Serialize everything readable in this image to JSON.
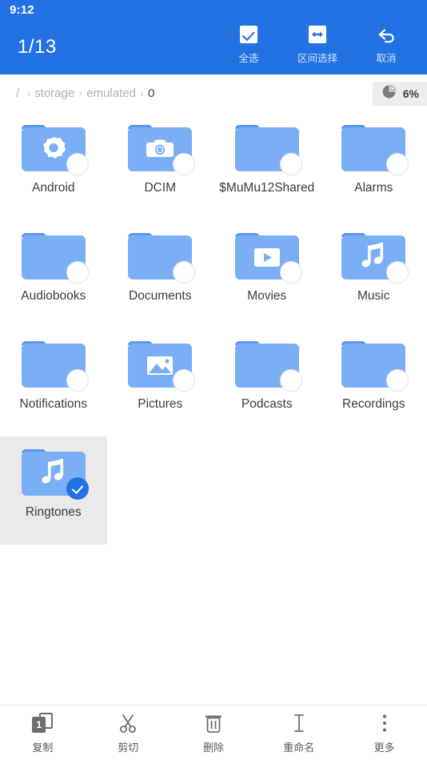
{
  "status_bar": {
    "time": "9:12"
  },
  "header": {
    "selection_count": "1/13",
    "accent_color": "#2272e3",
    "actions": [
      {
        "icon": "select-all-checkbox-icon",
        "label": "全选"
      },
      {
        "icon": "range-select-icon",
        "label": "区间选择"
      },
      {
        "icon": "cancel-undo-icon",
        "label": "取消"
      }
    ]
  },
  "breadcrumb": {
    "items": [
      {
        "label": "/",
        "current": false
      },
      {
        "label": "storage",
        "current": false
      },
      {
        "label": "emulated",
        "current": false
      },
      {
        "label": "0",
        "current": true
      }
    ],
    "separator": "›"
  },
  "storage_badge": {
    "icon": "pie-chart-icon",
    "percent": "6%",
    "background_color": "#ededed"
  },
  "files": {
    "folder_body_color": "#7baff5",
    "folder_tab_color": "#5a97ef",
    "selected_highlight_color": "#eaeaea",
    "items": [
      {
        "name": "Android",
        "icon": "gear-icon",
        "selected": false
      },
      {
        "name": "DCIM",
        "icon": "camera-icon",
        "selected": false
      },
      {
        "name": "$MuMu12Shared",
        "icon": "none",
        "selected": false
      },
      {
        "name": "Alarms",
        "icon": "none",
        "selected": false
      },
      {
        "name": "Audiobooks",
        "icon": "none",
        "selected": false
      },
      {
        "name": "Documents",
        "icon": "none",
        "selected": false
      },
      {
        "name": "Movies",
        "icon": "video-icon",
        "selected": false
      },
      {
        "name": "Music",
        "icon": "music-icon",
        "selected": false
      },
      {
        "name": "Notifications",
        "icon": "none",
        "selected": false
      },
      {
        "name": "Pictures",
        "icon": "image-icon",
        "selected": false
      },
      {
        "name": "Podcasts",
        "icon": "none",
        "selected": false
      },
      {
        "name": "Recordings",
        "icon": "none",
        "selected": false
      },
      {
        "name": "Ringtones",
        "icon": "music-icon",
        "selected": true
      }
    ]
  },
  "bottom_toolbar": {
    "items": [
      {
        "icon": "copy-icon",
        "label": "复制",
        "badge": "1"
      },
      {
        "icon": "scissors-icon",
        "label": "剪切"
      },
      {
        "icon": "trash-icon",
        "label": "删除"
      },
      {
        "icon": "rename-icon",
        "label": "重命名"
      },
      {
        "icon": "more-dots-icon",
        "label": "更多"
      }
    ]
  }
}
